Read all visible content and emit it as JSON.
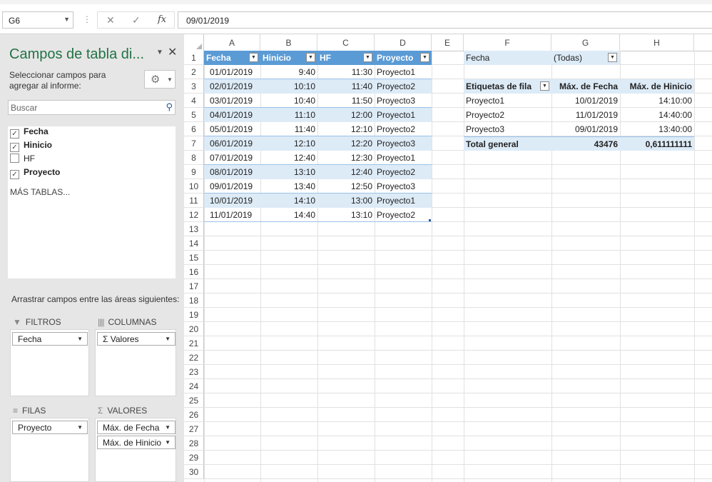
{
  "formula_bar": {
    "name_box": "G6",
    "separator": "⋮",
    "cancel_glyph": "✕",
    "enter_glyph": "✓",
    "fx_glyph": "fx",
    "value": "09/01/2019"
  },
  "pivot_pane": {
    "title": "Campos de tabla di...",
    "subtitle": "Seleccionar campos para agregar al informe:",
    "search_placeholder": "Buscar",
    "fields": [
      {
        "label": "Fecha",
        "checked": true
      },
      {
        "label": "Hinicio",
        "checked": true
      },
      {
        "label": "HF",
        "checked": false
      },
      {
        "label": "Proyecto",
        "checked": true
      }
    ],
    "more_tables": "MÁS TABLAS...",
    "drag_label": "Arrastrar campos entre las áreas siguientes:",
    "areas": {
      "filters": {
        "label": "FILTROS",
        "items": [
          "Fecha"
        ]
      },
      "columns": {
        "label": "COLUMNAS",
        "items": [
          "Σ  Valores"
        ]
      },
      "rows": {
        "label": "FILAS",
        "items": [
          "Proyecto"
        ]
      },
      "values": {
        "label": "VALORES",
        "items": [
          "Máx. de Fecha",
          "Máx. de Hinicio"
        ]
      }
    }
  },
  "sheet": {
    "columns": [
      "A",
      "B",
      "C",
      "D",
      "E",
      "F",
      "G",
      "H"
    ],
    "row_numbers": [
      "1",
      "2",
      "3",
      "4",
      "5",
      "6",
      "7",
      "8",
      "9",
      "10",
      "11",
      "12",
      "13",
      "14",
      "15",
      "16",
      "17",
      "18",
      "19",
      "20",
      "21",
      "22",
      "23",
      "24",
      "25",
      "26",
      "27",
      "28",
      "29",
      "30"
    ],
    "table_headers": [
      "Fecha",
      "Hinicio",
      "HF",
      "Proyecto"
    ],
    "table_rows": [
      [
        "01/01/2019",
        "9:40",
        "11:30",
        "Proyecto1"
      ],
      [
        "02/01/2019",
        "10:10",
        "11:40",
        "Proyecto2"
      ],
      [
        "03/01/2019",
        "10:40",
        "11:50",
        "Proyecto3"
      ],
      [
        "04/01/2019",
        "11:10",
        "12:00",
        "Proyecto1"
      ],
      [
        "05/01/2019",
        "11:40",
        "12:10",
        "Proyecto2"
      ],
      [
        "06/01/2019",
        "12:10",
        "12:20",
        "Proyecto3"
      ],
      [
        "07/01/2019",
        "12:40",
        "12:30",
        "Proyecto1"
      ],
      [
        "08/01/2019",
        "13:10",
        "12:40",
        "Proyecto2"
      ],
      [
        "09/01/2019",
        "13:40",
        "12:50",
        "Proyecto3"
      ],
      [
        "10/01/2019",
        "14:10",
        "13:00",
        "Proyecto1"
      ],
      [
        "11/01/2019",
        "14:40",
        "13:10",
        "Proyecto2"
      ]
    ],
    "pivot": {
      "filter_label": "Fecha",
      "filter_value": "(Todas)",
      "headers": [
        "Etiquetas de fila",
        "Máx. de Fecha",
        "Máx. de Hinicio"
      ],
      "rows": [
        [
          "Proyecto1",
          "10/01/2019",
          "14:10:00"
        ],
        [
          "Proyecto2",
          "11/01/2019",
          "14:40:00"
        ],
        [
          "Proyecto3",
          "09/01/2019",
          "13:40:00"
        ]
      ],
      "total": [
        "Total general",
        "43476",
        "0,611111111"
      ]
    }
  }
}
